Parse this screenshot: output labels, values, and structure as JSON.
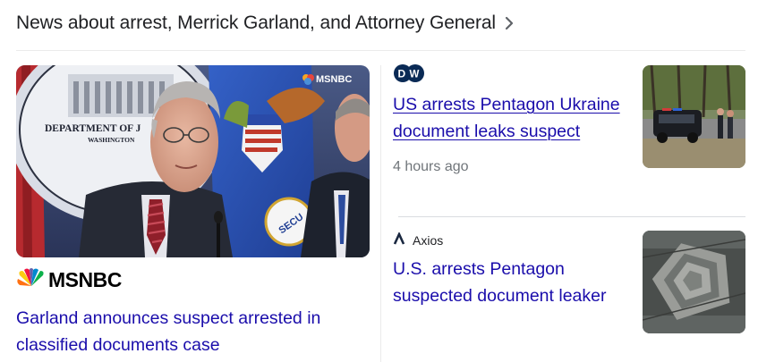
{
  "header": {
    "title": "News about arrest, Merrick Garland, and Attorney General",
    "chevron_icon": "chevron-right-icon"
  },
  "feature": {
    "image_alt_text": {
      "seal_line1": "DEPARTMENT OF J",
      "seal_line2": "WASHINGTON",
      "watermark": "MSNBC",
      "flag_text": "SECU"
    },
    "source_logo": "msnbc-peacock-icon",
    "source_name": "MSNBC",
    "headline": "Garland announces suspect arrested in classified documents case"
  },
  "stories": [
    {
      "source_logo": "dw-logo-icon",
      "source_logo_text": "DW",
      "headline": "US arrests Pentagon Ukraine document leaks suspect",
      "time": "4 hours ago",
      "thumbnail": "police-cars-thumbnail"
    },
    {
      "source_logo": "axios-logo-icon",
      "source_name": "Axios",
      "headline": "U.S. arrests Pentagon suspected document leaker",
      "thumbnail": "pentagon-aerial-thumbnail"
    }
  ],
  "colors": {
    "link": "#1a0dab",
    "text": "#202124",
    "muted": "#70757a",
    "divider": "#ebebeb"
  }
}
